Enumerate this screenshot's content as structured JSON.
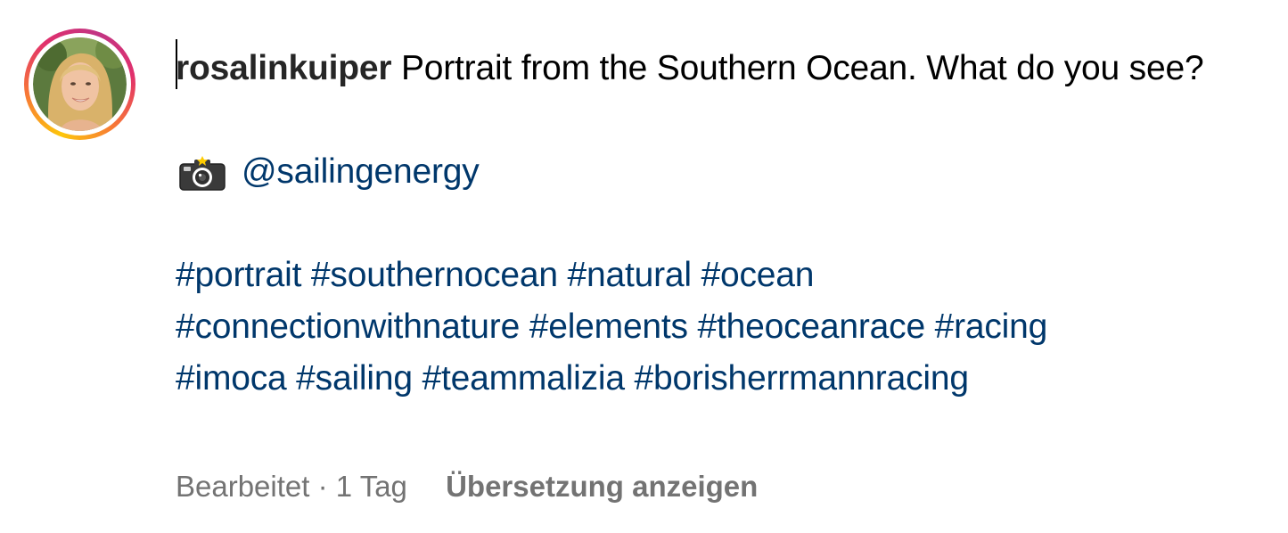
{
  "post": {
    "username": "rosalinkuiper",
    "caption_line": "Portrait from the Southern Ocean. What do you see?",
    "credit_icon": "camera-icon",
    "credit_mention": "@sailingenergy",
    "hashtags": [
      "#portrait",
      "#southernocean",
      "#natural",
      "#ocean",
      "#connectionwithnature",
      "#elements",
      "#theoceanrace",
      "#racing",
      "#imoca",
      "#sailing",
      "#teammalizia",
      "#borisherrmannracing"
    ]
  },
  "meta": {
    "edited": "Bearbeitet",
    "separator": " · ",
    "age": "1 Tag",
    "translate_label": "Übersetzung anzeigen"
  },
  "colors": {
    "link": "#00376b",
    "meta_text": "#737373",
    "story_ring_start": "#fdc60b",
    "story_ring_end": "#c13584"
  }
}
